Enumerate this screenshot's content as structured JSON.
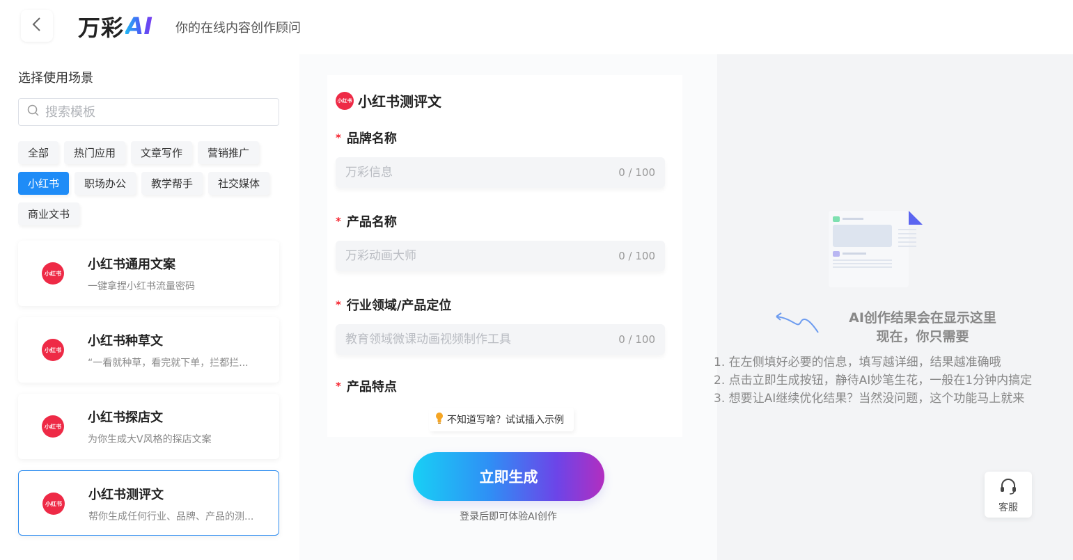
{
  "header": {
    "logo_text": "万彩",
    "logo_ai": "AI",
    "tagline": "你的在线内容创作顾问"
  },
  "sidebar": {
    "section_title": "选择使用场景",
    "search_placeholder": "搜索模板",
    "tags_row1": [
      "全部",
      "热门应用",
      "文章写作",
      "营销推广"
    ],
    "tags_row2": [
      "小红书",
      "职场办公",
      "教学帮手",
      "社交媒体"
    ],
    "tags_row3": [
      "商业文书"
    ],
    "active_tag": "小红书",
    "badge_text": "小红书",
    "cards": [
      {
        "title": "小红书通用文案",
        "desc": "一键拿捏小红书流量密码"
      },
      {
        "title": "小红书种草文",
        "desc": "“一看就种草，看完就下单，拦都拦..."
      },
      {
        "title": "小红书探店文",
        "desc": "为你生成大V风格的探店文案"
      },
      {
        "title": "小红书测评文",
        "desc": "帮你生成任何行业、品牌、产品的测..."
      }
    ]
  },
  "form": {
    "title": "小红书测评文",
    "badge_text": "小红书",
    "required_mark": "*",
    "fields": [
      {
        "label": "品牌名称",
        "placeholder": "万彩信息",
        "counter": "0 / 100"
      },
      {
        "label": "产品名称",
        "placeholder": "万彩动画大师",
        "counter": "0 / 100"
      },
      {
        "label": "行业领域/产品定位",
        "placeholder": "教育领域微课动画视频制作工具",
        "counter": "0 / 100"
      },
      {
        "label": "产品特点"
      }
    ],
    "hint": "不知道写啥？试试插入示例",
    "generate_button": "立即生成",
    "login_note": "登录后即可体验AI创作"
  },
  "result": {
    "title": "AI创作结果会在显示这里",
    "subtitle": "现在，你只需要",
    "steps": [
      "1. 在左侧填好必要的信息，填写越详细，结果越准确哦",
      "2. 点击立即生成按钮，静待AI妙笔生花，一般在1分钟内搞定",
      "3. 想要让AI继续优化结果？当然没问题，这个功能马上就来"
    ],
    "service_label": "客服"
  },
  "colors": {
    "primary": "#1f8cf7",
    "xhs_red": "#ee2a46",
    "required": "#f5222d"
  }
}
